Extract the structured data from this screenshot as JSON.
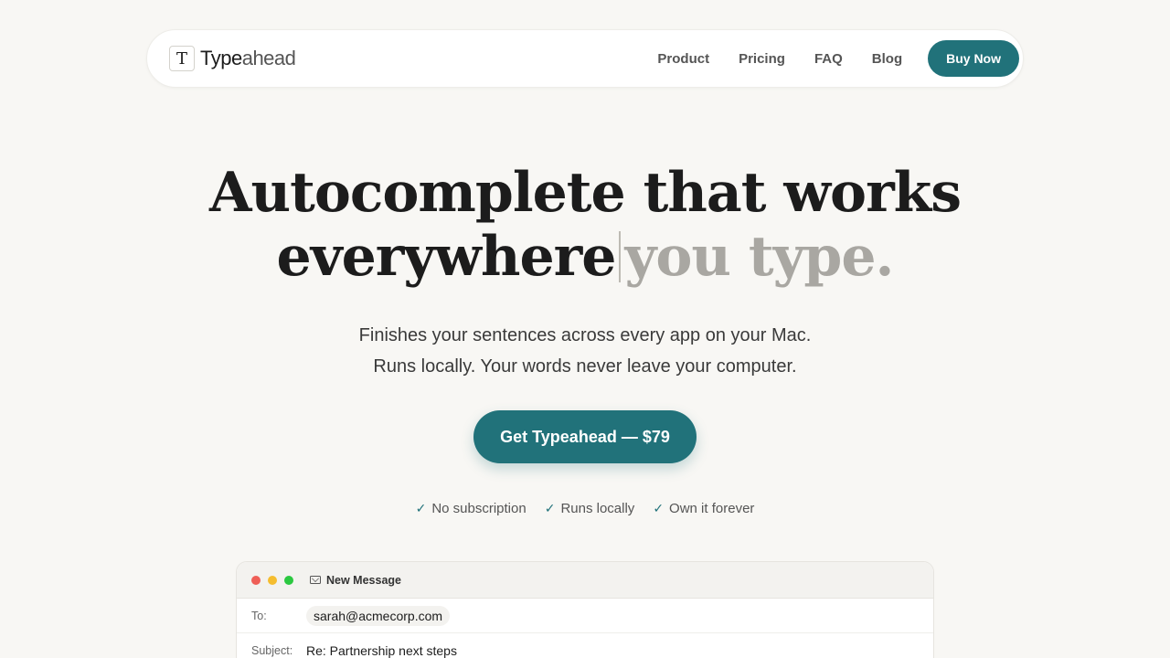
{
  "nav": {
    "brand": {
      "icon": "T",
      "name_part1": "Type",
      "name_part2": "ahead"
    },
    "links": [
      "Product",
      "Pricing",
      "FAQ",
      "Blog"
    ],
    "buy_label": "Buy Now"
  },
  "hero": {
    "title_line1": "Autocomplete that works",
    "title_typed": "everywhere",
    "title_ghost": "you type.",
    "sub_line1": "Finishes your sentences across every app on your Mac.",
    "sub_line2": "Runs locally. Your words never leave your computer.",
    "cta_label": "Get Typeahead — $79"
  },
  "perks": [
    "No subscription",
    "Runs locally",
    "Own it forever"
  ],
  "mail": {
    "window_title": "New Message",
    "to_label": "To:",
    "to_value": "sarah@acmecorp.com",
    "subject_label": "Subject:",
    "subject_value": "Re: Partnership next steps"
  },
  "colors": {
    "accent": "#21727a",
    "background": "#f8f7f4",
    "ghost_text": "#a9a7a2"
  },
  "icons": [
    "text-cursor-icon",
    "check-icon",
    "envelope-icon"
  ]
}
